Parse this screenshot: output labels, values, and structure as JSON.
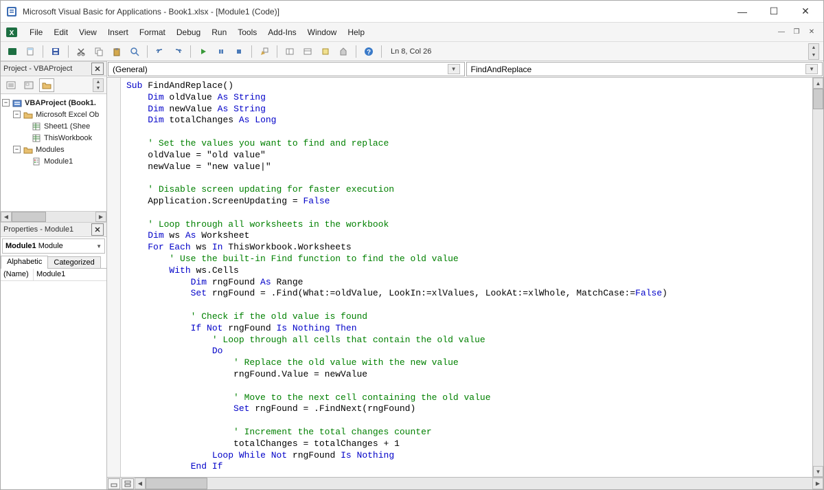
{
  "window": {
    "title": "Microsoft Visual Basic for Applications - Book1.xlsx - [Module1 (Code)]"
  },
  "menu": {
    "file": "File",
    "edit": "Edit",
    "view": "View",
    "insert": "Insert",
    "format": "Format",
    "debug": "Debug",
    "run": "Run",
    "tools": "Tools",
    "addins": "Add-Ins",
    "window": "Window",
    "help": "Help"
  },
  "toolbar": {
    "cursor_pos": "Ln 8, Col 26"
  },
  "project_panel": {
    "title": "Project - VBAProject",
    "root": "VBAProject (Book1.",
    "excel_objects": "Microsoft Excel Ob",
    "sheet1": "Sheet1 (Shee",
    "thisworkbook": "ThisWorkbook",
    "modules": "Modules",
    "module1": "Module1"
  },
  "properties_panel": {
    "title": "Properties - Module1",
    "dropdown_bold": "Module1",
    "dropdown_rest": "Module",
    "tab_alpha": "Alphabetic",
    "tab_cat": "Categorized",
    "prop_name": "(Name)",
    "prop_value": "Module1"
  },
  "code_dropdowns": {
    "left": "(General)",
    "right": "FindAndReplace"
  },
  "code": {
    "l01a": "Sub",
    "l01b": " FindAndReplace()",
    "l02a": "    ",
    "l02b": "Dim",
    "l02c": " oldValue ",
    "l02d": "As",
    "l02e": " ",
    "l02f": "String",
    "l03a": "    ",
    "l03b": "Dim",
    "l03c": " newValue ",
    "l03d": "As",
    "l03e": " ",
    "l03f": "String",
    "l04a": "    ",
    "l04b": "Dim",
    "l04c": " totalChanges ",
    "l04d": "As",
    "l04e": " ",
    "l04f": "Long",
    "l05": "",
    "l06a": "    ",
    "l06b": "' Set the values you want to find and replace",
    "l07": "    oldValue = \"old value\"",
    "l08": "    newValue = \"new value|\"",
    "l09": "",
    "l10a": "    ",
    "l10b": "' Disable screen updating for faster execution",
    "l11a": "    Application.ScreenUpdating = ",
    "l11b": "False",
    "l12": "",
    "l13a": "    ",
    "l13b": "' Loop through all worksheets in the workbook",
    "l14a": "    ",
    "l14b": "Dim",
    "l14c": " ws ",
    "l14d": "As",
    "l14e": " Worksheet",
    "l15a": "    ",
    "l15b": "For",
    "l15c": " ",
    "l15d": "Each",
    "l15e": " ws ",
    "l15f": "In",
    "l15g": " ThisWorkbook.Worksheets",
    "l16a": "        ",
    "l16b": "' Use the built-in Find function to find the old value",
    "l17a": "        ",
    "l17b": "With",
    "l17c": " ws.Cells",
    "l18a": "            ",
    "l18b": "Dim",
    "l18c": " rngFound ",
    "l18d": "As",
    "l18e": " Range",
    "l19a": "            ",
    "l19b": "Set",
    "l19c": " rngFound = .Find(What:=oldValue, LookIn:=xlValues, LookAt:=xlWhole, MatchCase:=",
    "l19d": "False",
    "l19e": ")",
    "l20": "",
    "l21a": "            ",
    "l21b": "' Check if the old value is found",
    "l22a": "            ",
    "l22b": "If",
    "l22c": " ",
    "l22d": "Not",
    "l22e": " rngFound ",
    "l22f": "Is",
    "l22g": " ",
    "l22h": "Nothing",
    "l22i": " ",
    "l22j": "Then",
    "l23a": "                ",
    "l23b": "' Loop through all cells that contain the old value",
    "l24a": "                ",
    "l24b": "Do",
    "l25a": "                    ",
    "l25b": "' Replace the old value with the new value",
    "l26": "                    rngFound.Value = newValue",
    "l27": "",
    "l28a": "                    ",
    "l28b": "' Move to the next cell containing the old value",
    "l29a": "                    ",
    "l29b": "Set",
    "l29c": " rngFound = .FindNext(rngFound)",
    "l30": "",
    "l31a": "                    ",
    "l31b": "' Increment the total changes counter",
    "l32": "                    totalChanges = totalChanges + 1",
    "l33a": "                ",
    "l33b": "Loop",
    "l33c": " ",
    "l33d": "While",
    "l33e": " ",
    "l33f": "Not",
    "l33g": " rngFound ",
    "l33h": "Is",
    "l33i": " ",
    "l33j": "Nothing",
    "l34a": "            ",
    "l34b": "End",
    "l34c": " ",
    "l34d": "If"
  }
}
